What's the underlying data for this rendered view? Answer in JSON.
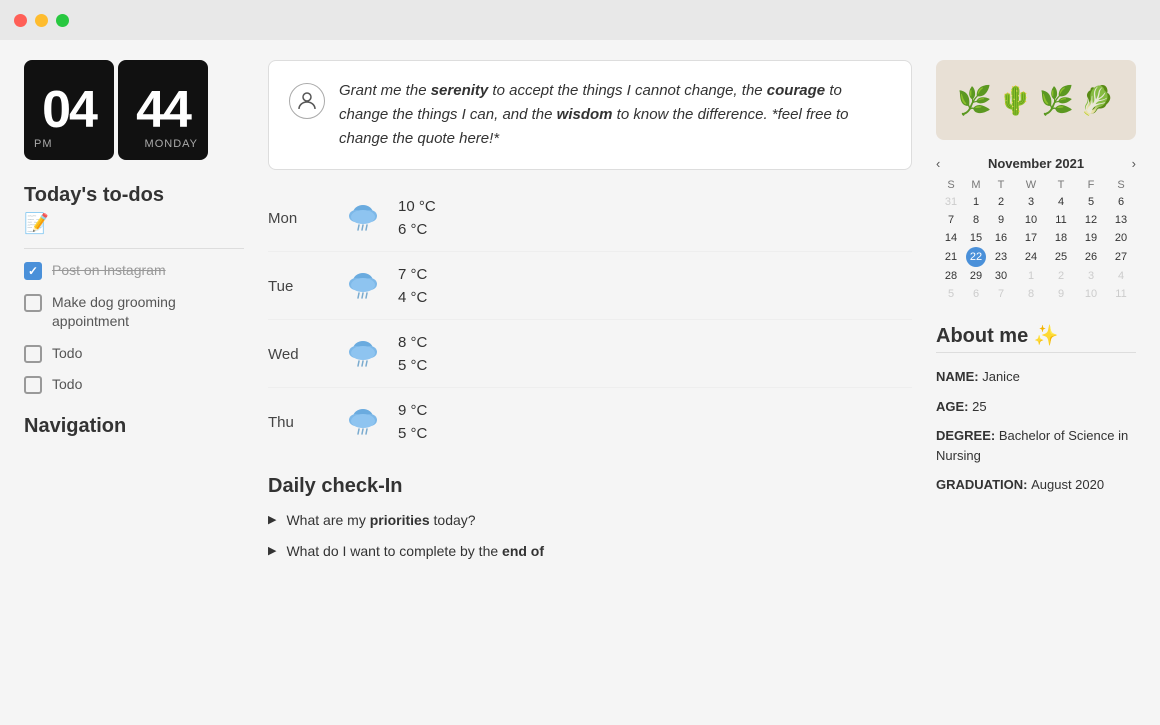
{
  "titlebar": {
    "buttons": [
      "red",
      "yellow",
      "green"
    ]
  },
  "clock": {
    "hours": "04",
    "minutes": "44",
    "period": "PM",
    "day": "MONDAY"
  },
  "todos": {
    "section_title": "Today's to-dos",
    "emoji": "📝",
    "items": [
      {
        "id": 1,
        "text": "Post on Instagram",
        "checked": true
      },
      {
        "id": 2,
        "text": "Make dog grooming appointment",
        "checked": false
      },
      {
        "id": 3,
        "text": "Todo",
        "checked": false
      },
      {
        "id": 4,
        "text": "Todo",
        "checked": false
      }
    ]
  },
  "navigation": {
    "title": "Navigation"
  },
  "quote": {
    "text_parts": [
      {
        "text": "Grant me the ",
        "bold": false
      },
      {
        "text": "serenity",
        "bold": true
      },
      {
        "text": " to accept the things I cannot change, the ",
        "bold": false
      },
      {
        "text": "courage",
        "bold": true
      },
      {
        "text": " to change the things I can, and the ",
        "bold": false
      },
      {
        "text": "wisdom",
        "bold": true
      },
      {
        "text": " to know the difference. *feel free to change the quote here!*",
        "bold": false
      }
    ],
    "full_text": "Grant me the serenity to accept the things I cannot change, the courage to change the things I can, and the wisdom to know the difference. *feel free to change the quote here!*"
  },
  "weather": {
    "days": [
      {
        "day": "Mon",
        "icon": "🌧️",
        "high": "10 °C",
        "low": "6 °C"
      },
      {
        "day": "Tue",
        "icon": "🌧️",
        "high": "7 °C",
        "low": "4 °C"
      },
      {
        "day": "Wed",
        "icon": "🌧️",
        "high": "8 °C",
        "low": "5 °C"
      },
      {
        "day": "Thu",
        "icon": "🌧️",
        "high": "9 °C",
        "low": "5 °C"
      }
    ]
  },
  "checkin": {
    "title": "Daily check-In",
    "items": [
      {
        "text_parts": [
          {
            "text": "What are my ",
            "bold": false
          },
          {
            "text": "priorities",
            "bold": true
          },
          {
            "text": " today?",
            "bold": false
          }
        ]
      },
      {
        "text_parts": [
          {
            "text": "What do I want to complete by the ",
            "bold": false
          },
          {
            "text": "end of",
            "bold": true
          }
        ]
      }
    ]
  },
  "plants": {
    "emojis": [
      "🌿",
      "🌵",
      "🌿",
      "🥬"
    ]
  },
  "calendar": {
    "month": "November 2021",
    "days_of_week": [
      "S",
      "M",
      "T",
      "W",
      "T",
      "F",
      "S"
    ],
    "weeks": [
      [
        "31",
        "1",
        "2",
        "3",
        "4",
        "5",
        "6"
      ],
      [
        "7",
        "8",
        "9",
        "10",
        "11",
        "12",
        "13"
      ],
      [
        "14",
        "15",
        "16",
        "17",
        "18",
        "19",
        "20"
      ],
      [
        "21",
        "22",
        "23",
        "24",
        "25",
        "26",
        "27"
      ],
      [
        "28",
        "29",
        "30",
        "1",
        "2",
        "3",
        "4"
      ],
      [
        "5",
        "6",
        "7",
        "8",
        "9",
        "10",
        "11"
      ]
    ],
    "today": "22",
    "other_month_start": [
      "31"
    ],
    "other_month_end": [
      "1",
      "2",
      "3",
      "4",
      "5",
      "6",
      "7",
      "8",
      "9",
      "10",
      "11"
    ]
  },
  "about": {
    "title": "About me",
    "sparkle": "✨",
    "fields": [
      {
        "label": "NAME",
        "value": "Janice"
      },
      {
        "label": "AGE",
        "value": "25"
      },
      {
        "label": "DEGREE",
        "value": "Bachelor of Science in Nursing"
      },
      {
        "label": "GRADUATION",
        "value": "August 2020"
      }
    ]
  }
}
